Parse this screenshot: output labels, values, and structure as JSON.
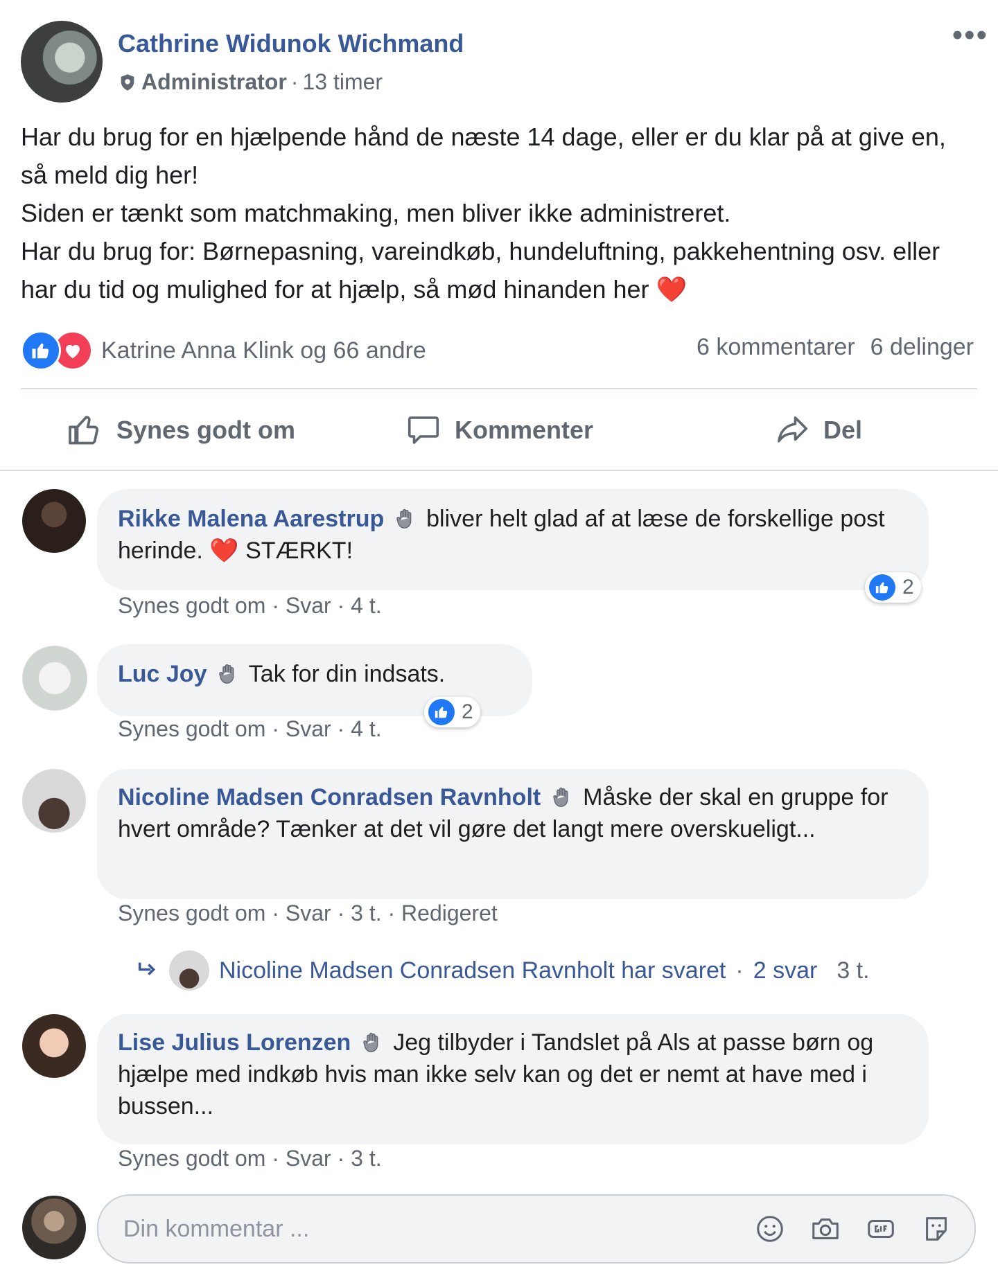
{
  "post": {
    "author": "Cathrine Widunok Wichmand",
    "role": "Administrator",
    "separator": "·",
    "time": "13 timer",
    "more": "•••",
    "body_lines": [
      "Har du brug for en hjælpende hånd de næste 14 dage, eller er du klar på at give en, så meld dig her!",
      "Siden er tænkt som matchmaking, men bliver ikke administreret.",
      "Har du brug for: Børnepasning, vareindkøb, hundeluftning, pakkehentning osv. eller har du tid og mulighed for at hjælp, så mød hinanden her"
    ],
    "heart_emoji": "❤️"
  },
  "reactions": {
    "reactors": "Katrine Anna Klink og 66 andre",
    "comments_count": "6 kommentarer",
    "shares_count": "6 delinger"
  },
  "actions": {
    "like": "Synes godt om",
    "comment": "Kommenter",
    "share": "Del"
  },
  "comments": [
    {
      "name": "Rikke Malena Aarestrup",
      "text": "bliver helt glad af at læse de forskellige post herinde.",
      "text_end": "STÆRKT!",
      "like": "Synes godt om",
      "reply": "Svar",
      "time": "4 t.",
      "reaction_count": "2"
    },
    {
      "name": "Luc Joy",
      "text": "Tak for din indsats.",
      "like": "Synes godt om",
      "reply": "Svar",
      "time": "4 t.",
      "reaction_count": "2"
    },
    {
      "name": "Nicoline Madsen Conradsen Ravnholt",
      "text": "Måske der skal en gruppe for hvert område? Tænker at det vil gøre det langt mere overskueligt...",
      "like": "Synes godt om",
      "reply": "Svar",
      "time": "3 t.",
      "edited": "Redigeret",
      "replies_summary": "Nicoline Madsen Conradsen Ravnholt har svaret",
      "replies_count": "2 svar",
      "replies_time": "3 t."
    },
    {
      "name": "Lise Julius Lorenzen",
      "text": "Jeg tilbyder i Tandslet på Als at passe børn og hjælpe med indkøb hvis man ikke selv kan og det er nemt at have med i bussen...",
      "like": "Synes godt om",
      "reply": "Svar",
      "time": "3 t."
    }
  ],
  "composer": {
    "placeholder": "Din kommentar ..."
  },
  "colors": {
    "link": "#385898",
    "like_blue": "#2078f4",
    "love_red": "#f33e58",
    "bubble_bg": "#f2f3f5",
    "meta_grey": "#606770"
  },
  "icons": [
    "admin-shield-icon",
    "more-options-icon",
    "like-reaction-icon",
    "love-reaction-icon",
    "thumbs-up-icon",
    "comment-icon",
    "share-icon",
    "wave-badge-icon",
    "reply-arrow-icon",
    "emoji-icon",
    "camera-icon",
    "gif-icon",
    "sticker-icon"
  ]
}
